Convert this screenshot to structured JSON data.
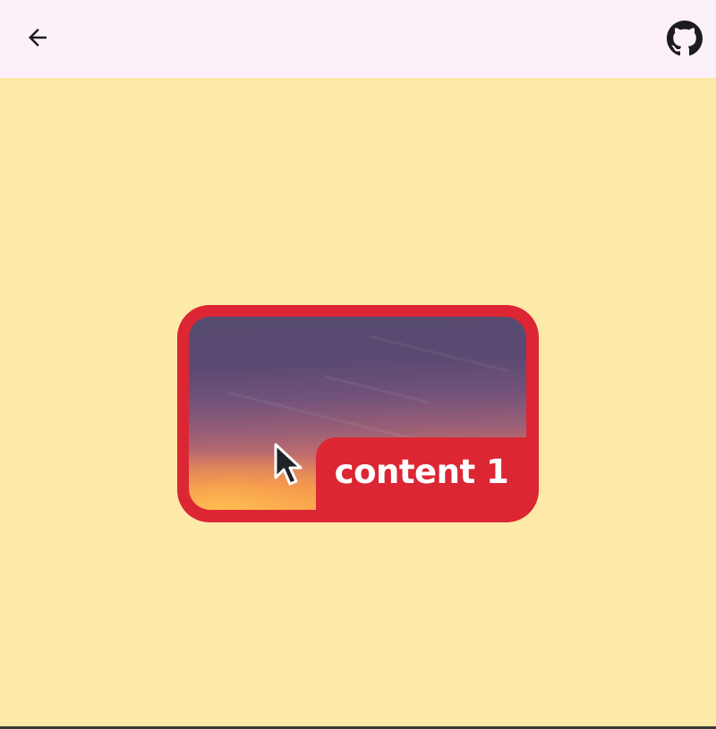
{
  "appbar": {
    "back_icon": "arrow-left-icon",
    "github_icon": "github-icon",
    "background": "#fcf0fb"
  },
  "main": {
    "background": "#fde9a8",
    "card": {
      "border_color": "#dc2634",
      "label": "content 1",
      "image": "sunset-sky"
    }
  }
}
